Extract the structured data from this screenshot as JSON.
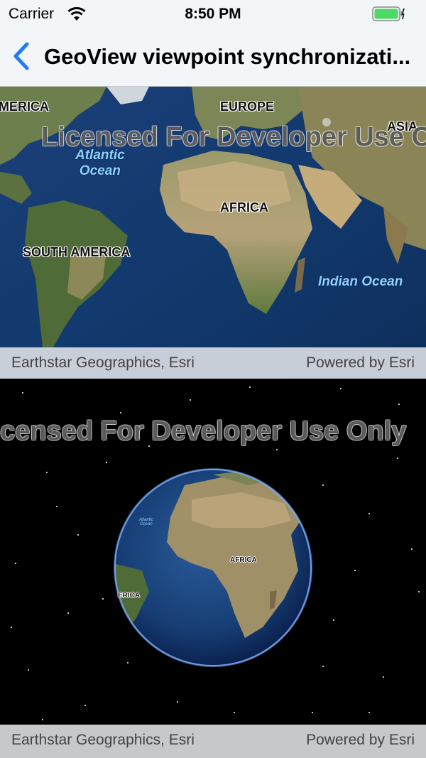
{
  "status": {
    "carrier": "Carrier",
    "time": "8:50 PM"
  },
  "nav": {
    "title": "GeoView viewpoint synchronizati..."
  },
  "map": {
    "watermark": "Licensed For Developer Use Only",
    "labels": {
      "america": "MERICA",
      "europe": "EUROPE",
      "asia": "ASIA",
      "africa": "AFRICA",
      "south_america": "SOUTH AMERICA"
    },
    "oceans": {
      "atlantic_1": "Atlantic",
      "atlantic_2": "Ocean",
      "indian": "Indian Ocean"
    },
    "attribution": "Earthstar Geographics, Esri",
    "powered_by": "Powered by Esri"
  },
  "scene": {
    "watermark": "censed For Developer Use Only",
    "globe_labels": {
      "africa": "AFRICA",
      "south_america": "ERICA"
    },
    "globe_ocean": {
      "line1": "Atlantic",
      "line2": "Ocean"
    },
    "attribution": "Earthstar Geographics, Esri",
    "powered_by": "Powered by Esri"
  },
  "colors": {
    "accent": "#1f7cf6",
    "battery": "#4cd964"
  }
}
